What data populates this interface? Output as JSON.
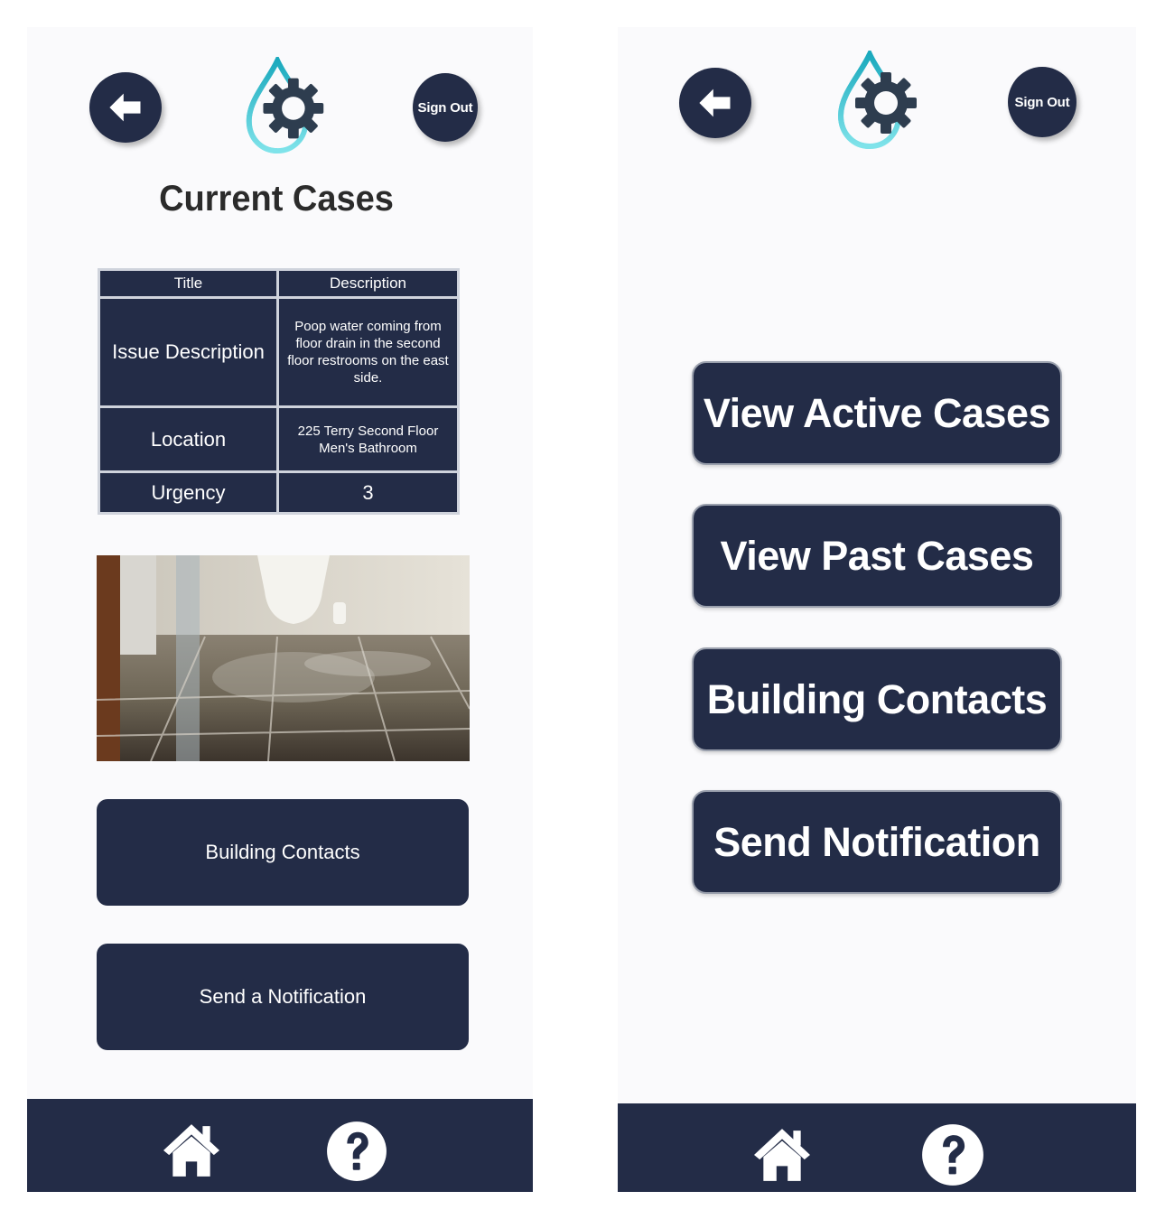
{
  "colors": {
    "primary": "#232c47",
    "title_text": "#2b2b2b",
    "logo_teal": "#2bbccb",
    "logo_gear": "#2e3d4f"
  },
  "left_screen": {
    "header": {
      "back_icon": "arrow-left-icon",
      "logo_icon": "water-drop-gear-logo",
      "sign_out_label": "Sign Out"
    },
    "title": "Current Cases",
    "table": {
      "headers": [
        "Title",
        "Description"
      ],
      "rows": [
        {
          "key": "Issue Description",
          "value": "Poop water coming from floor drain in the second floor restrooms on the east side."
        },
        {
          "key": "Location",
          "value": "225 Terry Second Floor Men's Bathroom"
        },
        {
          "key": "Urgency",
          "value": "3"
        }
      ]
    },
    "buttons": {
      "building_contacts": "Building Contacts",
      "send_notification": "Send a Notification"
    },
    "nav": {
      "home_icon": "home-icon",
      "help_icon": "help-icon"
    }
  },
  "right_screen": {
    "header": {
      "back_icon": "arrow-left-icon",
      "logo_icon": "water-drop-gear-logo",
      "sign_out_label": "Sign Out"
    },
    "menu": [
      "View Active Cases",
      "View Past Cases",
      "Building Contacts",
      "Send Notification"
    ],
    "nav": {
      "home_icon": "home-icon",
      "help_icon": "help-icon"
    }
  }
}
